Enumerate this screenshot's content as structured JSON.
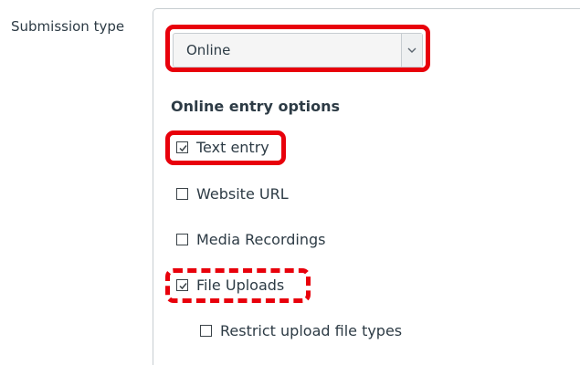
{
  "form": {
    "label": "Submission type",
    "select": {
      "value": "Online"
    },
    "section_title": "Online entry options",
    "options": [
      {
        "label": "Text entry",
        "checked": true
      },
      {
        "label": "Website URL",
        "checked": false
      },
      {
        "label": "Media Recordings",
        "checked": false
      },
      {
        "label": "File Uploads",
        "checked": true
      }
    ],
    "sub_option": {
      "label": "Restrict upload file types",
      "checked": false
    }
  },
  "icons": {
    "select_arrow": "chevron-down-icon",
    "checked": "checkmark-icon"
  },
  "colors": {
    "highlight": "#e8000b",
    "text": "#2d3b45",
    "border": "#c7cdd1"
  }
}
